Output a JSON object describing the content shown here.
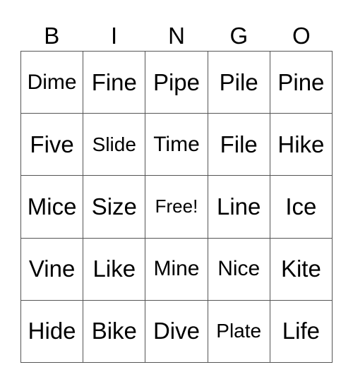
{
  "card": {
    "header": [
      "B",
      "I",
      "N",
      "G",
      "O"
    ],
    "rows": [
      [
        "Dime",
        "Fine",
        "Pipe",
        "Pile",
        "Pine"
      ],
      [
        "Five",
        "Slide",
        "Time",
        "File",
        "Hike"
      ],
      [
        "Mice",
        "Size",
        "Free!",
        "Line",
        "Ice"
      ],
      [
        "Vine",
        "Like",
        "Mine",
        "Nice",
        "Kite"
      ],
      [
        "Hide",
        "Bike",
        "Dive",
        "Plate",
        "Life"
      ]
    ]
  }
}
